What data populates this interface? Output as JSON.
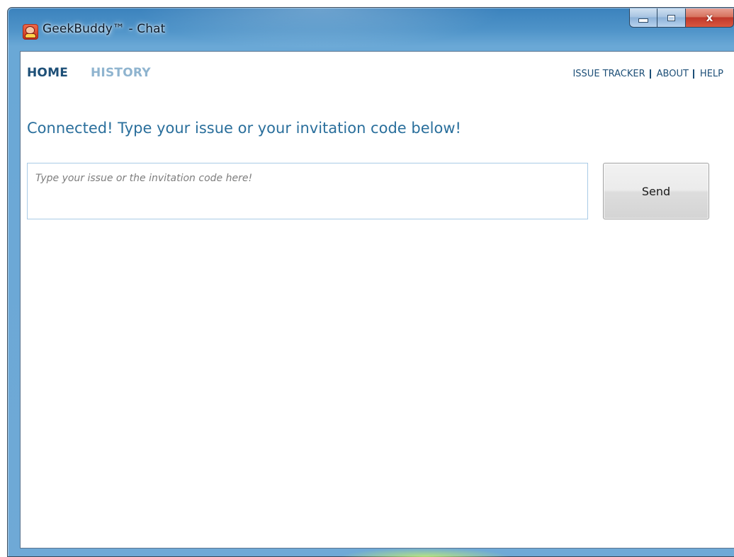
{
  "window": {
    "title": "GeekBuddy™ - Chat",
    "close_glyph": "x"
  },
  "nav": {
    "tabs": [
      {
        "label": "HOME",
        "active": true
      },
      {
        "label": "HISTORY",
        "active": false
      }
    ],
    "links": [
      {
        "label": "ISSUE TRACKER"
      },
      {
        "label": "ABOUT"
      },
      {
        "label": "HELP"
      }
    ]
  },
  "main": {
    "status_heading": "Connected! Type your issue or your invitation code below!",
    "input": {
      "value": "",
      "placeholder": "Type your issue or the invitation code here!"
    },
    "send_label": "Send"
  },
  "colors": {
    "accent": "#1d4f77",
    "heading": "#2a6f9c",
    "inactive_tab": "#8fb4cf",
    "input_border": "#a9cbe6"
  },
  "icons": [
    "app-icon",
    "minimize-icon",
    "maximize-icon",
    "close-icon"
  ]
}
